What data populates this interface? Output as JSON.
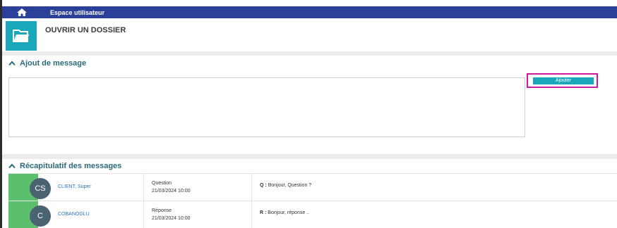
{
  "topbar": {
    "title": "Espace utilisateur"
  },
  "folder": {
    "title": "OUVRIR UN DOSSIER"
  },
  "add_section": {
    "title": "Ajout de message",
    "button_label": "Ajouter",
    "message_value": ""
  },
  "summary_section": {
    "title": "Récapitulatif des messages"
  },
  "messages": [
    {
      "initials": "CS",
      "author": "CLIENT, Super",
      "type": "Question",
      "date": "21/03/2024 10:00",
      "prefix": "Q :",
      "text": "Bonjour, Question ?"
    },
    {
      "initials": "C",
      "author": "COBANOGLU",
      "type": "Réponse",
      "date": "21/03/2024 10:00",
      "prefix": "R :",
      "text": "Bonjour, réponse .."
    }
  ],
  "colors": {
    "topbar": "#2b4199",
    "accent": "#1aa7b9",
    "highlight": "#cc1a9a",
    "row_accent": "#5cbf6e",
    "avatar": "#4a6373"
  }
}
